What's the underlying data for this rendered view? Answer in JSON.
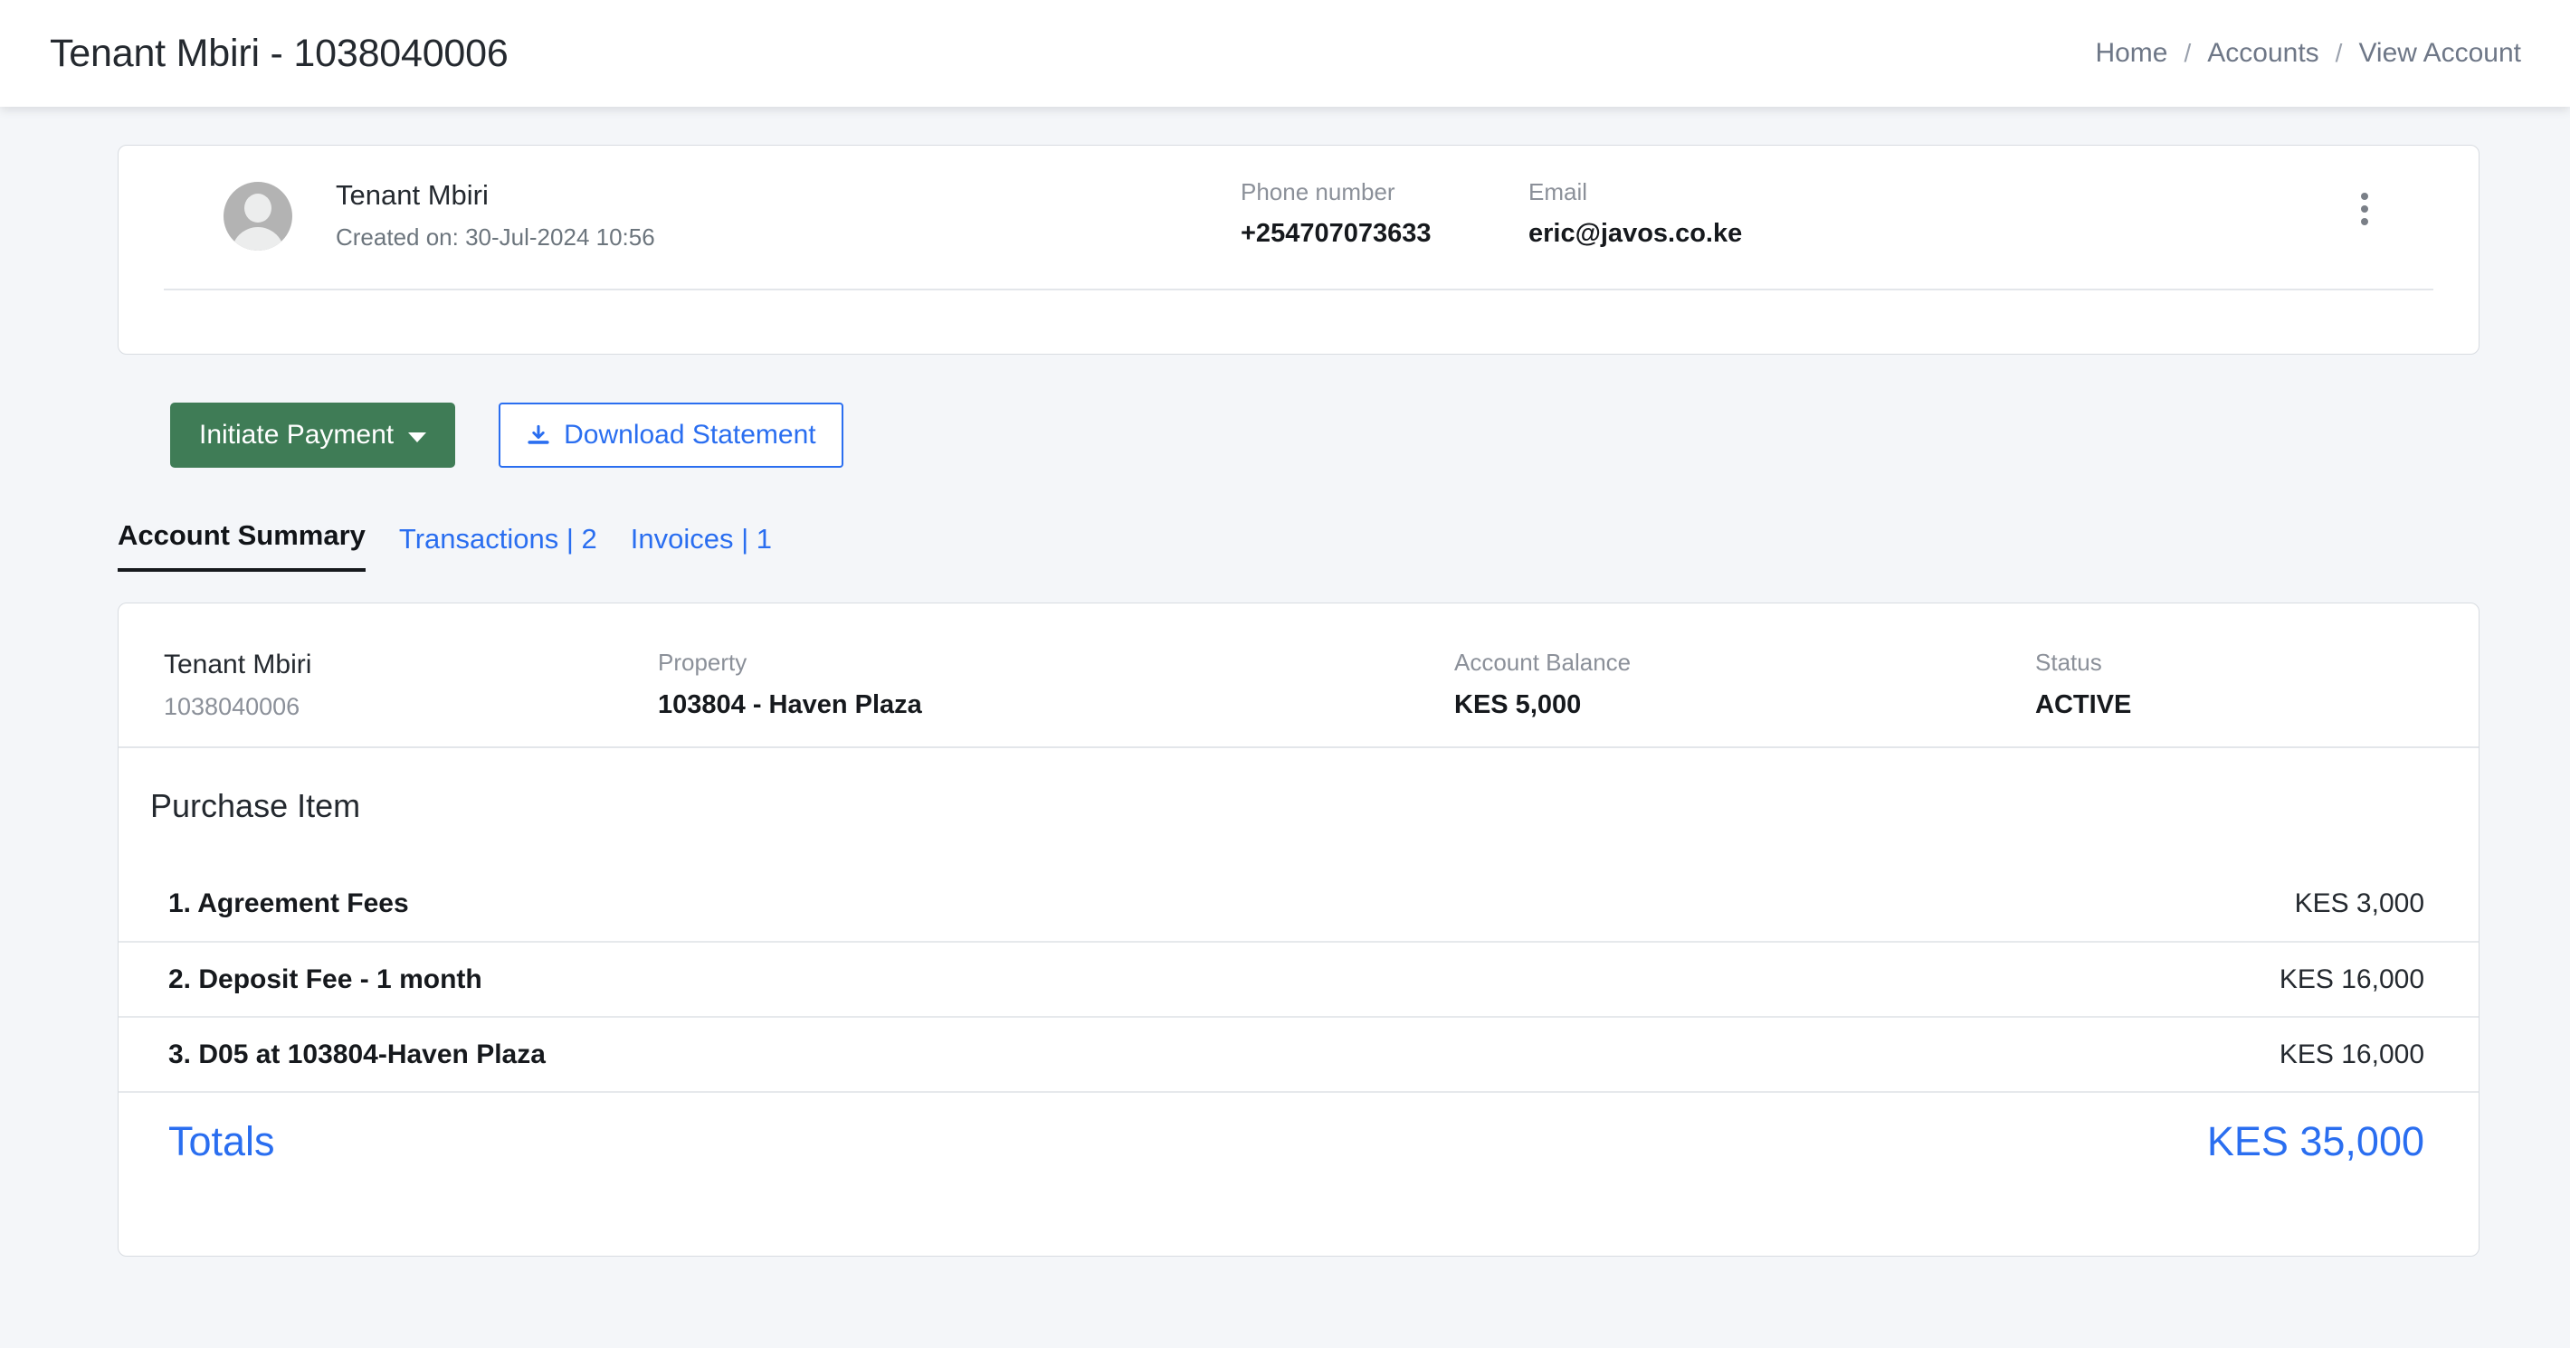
{
  "header": {
    "title": "Tenant Mbiri - 1038040006",
    "breadcrumb": {
      "home": "Home",
      "sep1": "/",
      "accounts": "Accounts",
      "sep2": "/",
      "current": "View Account"
    }
  },
  "profile": {
    "avatar_icon": "user-avatar-icon",
    "name": "Tenant Mbiri",
    "created": "Created on: 30-Jul-2024 10:56",
    "phone_label": "Phone number",
    "phone_value": "+254707073633",
    "email_label": "Email",
    "email_value": "eric@javos.co.ke",
    "menu_icon": "kebab-menu-icon"
  },
  "actions": {
    "initiate_payment": "Initiate Payment",
    "initiate_payment_caret": "chevron-down-icon",
    "download_statement": "Download Statement",
    "download_icon": "download-icon"
  },
  "tabs": [
    {
      "label": "Account Summary",
      "active": true
    },
    {
      "label": "Transactions | 2",
      "active": false
    },
    {
      "label": "Invoices | 1",
      "active": false
    }
  ],
  "summary": {
    "account_name": "Tenant Mbiri",
    "account_number": "1038040006",
    "property_label": "Property",
    "property_value": "103804 - Haven Plaza",
    "balance_label": "Account Balance",
    "balance_value": "KES 5,000",
    "status_label": "Status",
    "status_value": "ACTIVE",
    "purchase_heading": "Purchase Item",
    "items": [
      {
        "name": "1. Agreement Fees",
        "amount": "KES 3,000"
      },
      {
        "name": "2. Deposit Fee - 1 month",
        "amount": "KES 16,000"
      },
      {
        "name": "3. D05 at 103804-Haven Plaza",
        "amount": "KES 16,000"
      }
    ],
    "totals_label": "Totals",
    "totals_value": "KES 35,000"
  },
  "colors": {
    "primary_green": "#3f7c56",
    "link_blue": "#2a6ef0",
    "page_bg": "#f4f6f9",
    "card_bg": "#ffffff",
    "muted_text": "#8b9099"
  }
}
